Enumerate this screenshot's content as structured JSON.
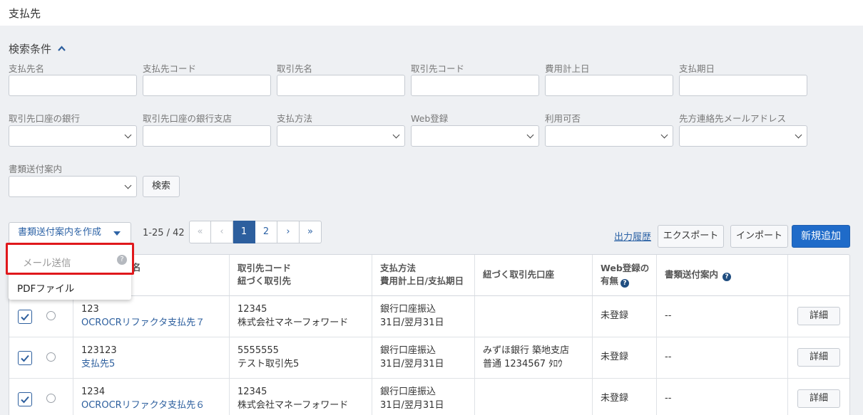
{
  "page": {
    "title": "支払先"
  },
  "search": {
    "title": "検索条件",
    "fields": [
      {
        "label": "支払先名",
        "type": "text"
      },
      {
        "label": "支払先コード",
        "type": "text"
      },
      {
        "label": "取引先名",
        "type": "text"
      },
      {
        "label": "取引先コード",
        "type": "text"
      },
      {
        "label": "費用計上日",
        "type": "text"
      },
      {
        "label": "支払期日",
        "type": "text"
      },
      {
        "label": "取引先口座の銀行",
        "type": "select"
      },
      {
        "label": "取引先口座の銀行支店",
        "type": "text"
      },
      {
        "label": "支払方法",
        "type": "select"
      },
      {
        "label": "Web登録",
        "type": "select"
      },
      {
        "label": "利用可否",
        "type": "select"
      },
      {
        "label": "先方連絡先メールアドレス",
        "type": "select"
      },
      {
        "label": "書類送付案内",
        "type": "select"
      }
    ],
    "search_button": "検索"
  },
  "toolbar": {
    "create_button": "書類送付案内を作成",
    "count": "1-25 / 42",
    "pages": [
      "«",
      "‹",
      "1",
      "2",
      "›",
      "»"
    ],
    "current_page": "1",
    "history_link": "出力履歴",
    "export_button": "エクスポート",
    "import_button": "インポート",
    "new_button": "新規追加"
  },
  "dropdown": {
    "items": [
      "メール送信",
      "PDFファイル"
    ],
    "help_icon": "?"
  },
  "table": {
    "headers": {
      "name_tail": "名",
      "code": [
        "取引先コード",
        "紐づく取引先"
      ],
      "method": [
        "支払方法",
        "費用計上日/支払期日"
      ],
      "account": "紐づく取引先口座",
      "web": [
        "Web登録の",
        "有無"
      ],
      "guide": "書類送付案内"
    },
    "rows": [
      {
        "code": "123",
        "name": "OCROCRリファクタ支払先７",
        "partner_code": "12345",
        "partner": "株式会社マネーフォワード",
        "method": "銀行口座振込",
        "dates": "31日/翌月31日",
        "account1": "",
        "account2": "",
        "web": "未登録",
        "guide": "--",
        "detail": "詳細"
      },
      {
        "code": "123123",
        "name": "支払先5",
        "partner_code": "5555555",
        "partner": "テスト取引先5",
        "method": "銀行口座振込",
        "dates": "31日/翌月31日",
        "account1": "みずほ銀行 築地支店",
        "account2": "普通 1234567 ﾀﾛｳ",
        "web": "未登録",
        "guide": "--",
        "detail": "詳細"
      },
      {
        "code": "1234",
        "name": "OCROCRリファクタ支払先６",
        "partner_code": "12345",
        "partner": "株式会社マネーフォワード",
        "method": "銀行口座振込",
        "dates": "31日/翌月31日",
        "account1": "",
        "account2": "",
        "web": "未登録",
        "guide": "--",
        "detail": "詳細"
      }
    ]
  }
}
